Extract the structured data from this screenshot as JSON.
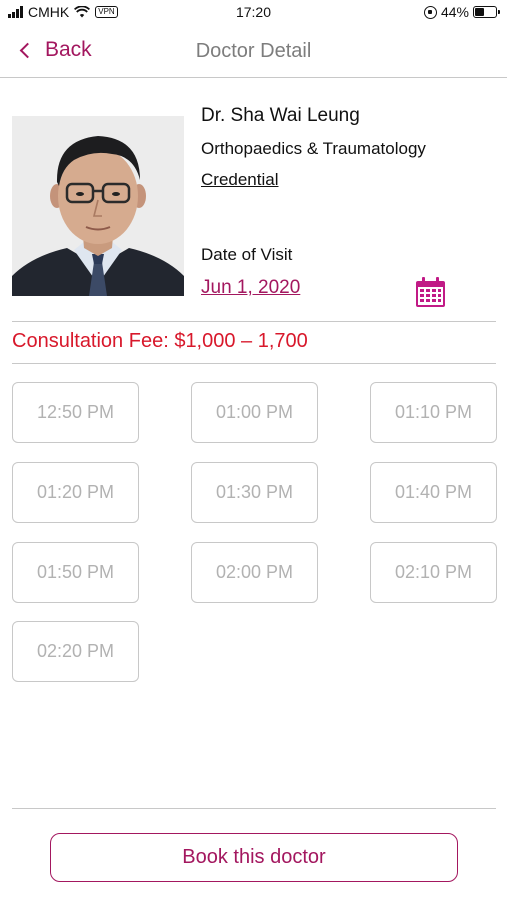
{
  "status_bar": {
    "carrier": "CMHK",
    "vpn_label": "VPN",
    "time": "17:20",
    "battery_text": "44%",
    "battery_level": 0.44
  },
  "nav": {
    "back_label": "Back",
    "title": "Doctor Detail"
  },
  "doctor": {
    "name": "Dr. Sha Wai Leung",
    "specialty": "Orthopaedics & Traumatology",
    "credential_link": "Credential"
  },
  "visit": {
    "label": "Date of Visit",
    "date": "Jun 1, 2020"
  },
  "fee": {
    "text": "Consultation Fee: $1,000 – 1,700"
  },
  "slots": [
    "12:50 PM",
    "01:00 PM",
    "01:10 PM",
    "01:20 PM",
    "01:30 PM",
    "01:40 PM",
    "01:50 PM",
    "02:00 PM",
    "02:10 PM",
    "02:20 PM"
  ],
  "actions": {
    "book_label": "Book this doctor"
  },
  "colors": {
    "accent": "#a3175f",
    "fee_red": "#d8182b",
    "slot_text": "#b2b2b2",
    "border": "#c8c8c8"
  }
}
